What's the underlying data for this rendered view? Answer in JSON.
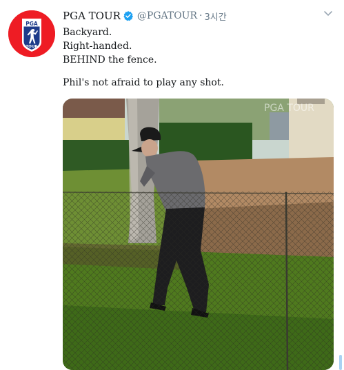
{
  "tweet": {
    "author_name": "PGA TOUR",
    "handle": "@PGATOUR",
    "separator": "·",
    "time": "3시간",
    "text_lines": [
      "Backyard.",
      "Right-handed.",
      "BEHIND the fence."
    ],
    "text_after": "Phil's not afraid to play any shot.",
    "avatar": {
      "logo_text": "PGA",
      "logo_text_2": "TOUR"
    },
    "media": {
      "watermark": "PGA TOUR"
    }
  },
  "colors": {
    "brand_red": "#ee1c24",
    "brand_blue": "#1d3b8a",
    "verified": "#1da1f2",
    "text_primary": "#14171a",
    "text_secondary": "#657786"
  },
  "icons": {
    "verified": "verified-badge-icon",
    "caret": "chevron-down-icon"
  }
}
